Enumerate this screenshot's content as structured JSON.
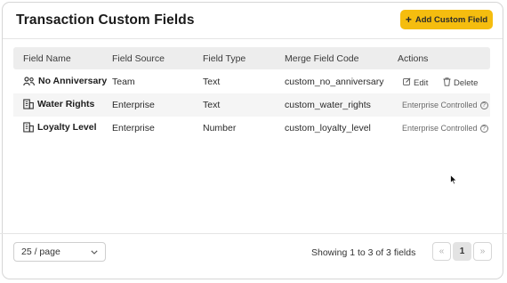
{
  "header": {
    "title": "Transaction Custom Fields",
    "add_button": "Add Custom Field"
  },
  "table": {
    "columns": [
      "Field Name",
      "Field Source",
      "Field Type",
      "Merge Field Code",
      "Actions"
    ],
    "rows": [
      {
        "icon": "people-icon",
        "name": "No Anniversary",
        "source": "Team",
        "type": "Text",
        "code": "custom_no_anniversary",
        "edit": "Edit",
        "delete": "Delete"
      },
      {
        "icon": "building-icon",
        "name": "Water Rights",
        "source": "Enterprise",
        "type": "Text",
        "code": "custom_water_rights",
        "controlled": "Enterprise Controlled"
      },
      {
        "icon": "building-icon",
        "name": "Loyalty Level",
        "source": "Enterprise",
        "type": "Number",
        "code": "custom_loyalty_level",
        "controlled": "Enterprise Controlled"
      }
    ]
  },
  "footer": {
    "page_size": "25 / page",
    "showing": "Showing 1 to 3 of 3 fields",
    "prev": "«",
    "current_page": "1",
    "next": "»"
  }
}
